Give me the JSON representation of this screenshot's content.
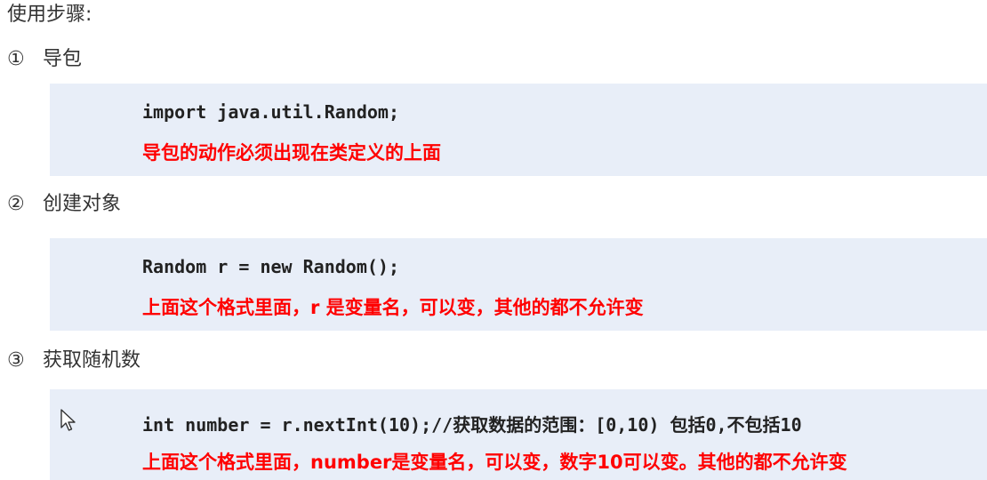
{
  "title": "使用步骤:",
  "steps": [
    {
      "number": "①",
      "label": "导包",
      "code": "import java.util.Random;",
      "note": "导包的动作必须出现在类定义的上面"
    },
    {
      "number": "②",
      "label": "创建对象",
      "code": "Random r = new Random();",
      "note": "上面这个格式里面，r 是变量名，可以变，其他的都不允许变"
    },
    {
      "number": "③",
      "label": "获取随机数",
      "code": "int number = r.nextInt(10);//获取数据的范围：[0,10) 包括0,不包括10",
      "note": "上面这个格式里面，number是变量名，可以变，数字10可以变。其他的都不允许变"
    }
  ],
  "colors": {
    "box_background": "#e8eef8",
    "note_color": "#ff0000",
    "text_color": "#333333"
  },
  "icons": {
    "cursor": "mouse-pointer-icon"
  }
}
